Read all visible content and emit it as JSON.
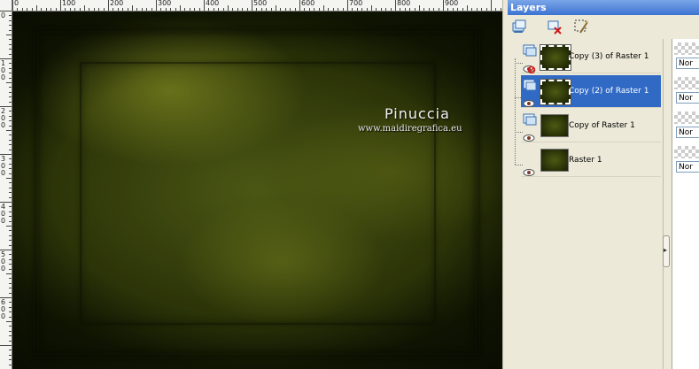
{
  "ruler": {
    "h_labels": [
      "0",
      "100",
      "200",
      "300",
      "400",
      "500",
      "600",
      "700",
      "800",
      "900"
    ],
    "v_labels": [
      "0",
      "100",
      "200",
      "300",
      "400",
      "500",
      "600"
    ]
  },
  "canvas": {
    "watermark_name": "Pinuccia",
    "watermark_url": "www.maidiregrafica.eu"
  },
  "layers_panel": {
    "title": "Layers",
    "toolbar": [
      {
        "icon": "new-raster-layer-icon"
      },
      {
        "icon": "delete-layer-icon"
      },
      {
        "icon": "edit-selection-icon"
      }
    ],
    "layers": [
      {
        "name": "Copy (3) of Raster 1",
        "visible": false,
        "selected": false,
        "blend": "Nor"
      },
      {
        "name": "Copy (2) of Raster 1",
        "visible": true,
        "selected": true,
        "blend": "Nor"
      },
      {
        "name": "Copy of Raster 1",
        "visible": true,
        "selected": false,
        "blend": "Nor"
      },
      {
        "name": "Raster 1",
        "visible": true,
        "selected": false,
        "blend": "Nor"
      }
    ]
  },
  "colors": {
    "selection": "#316ac5",
    "title_bar": "#3d72d1",
    "canvas_base": "#3a4410"
  }
}
